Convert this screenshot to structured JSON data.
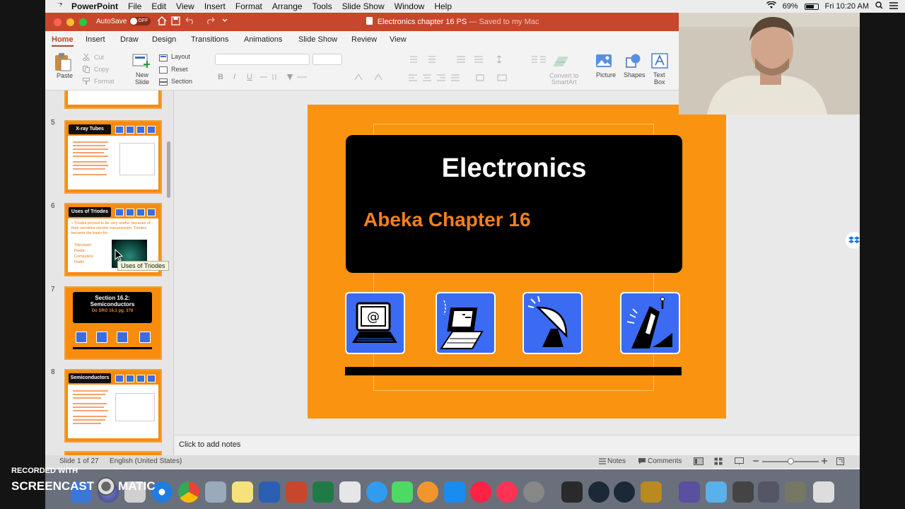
{
  "menubar": {
    "app": "PowerPoint",
    "items": [
      "File",
      "Edit",
      "View",
      "Insert",
      "Format",
      "Arrange",
      "Tools",
      "Slide Show",
      "Window",
      "Help"
    ],
    "battery": "69%",
    "clock": "Fri 10:20 AM"
  },
  "titlebar": {
    "autosave_label": "AutoSave",
    "autosave_state": "OFF",
    "doc_name": "Electronics chapter 16 PS",
    "saved_status": "— Saved to my Mac"
  },
  "tabs": [
    "Home",
    "Insert",
    "Draw",
    "Design",
    "Transitions",
    "Animations",
    "Slide Show",
    "Review",
    "View"
  ],
  "ribbon": {
    "paste": "Paste",
    "cut": "Cut",
    "copy": "Copy",
    "format": "Format",
    "new_slide_1": "New",
    "new_slide_2": "Slide",
    "layout": "Layout",
    "reset": "Reset",
    "section": "Section",
    "bold": "B",
    "italic": "I",
    "underline": "U",
    "convert_1": "Convert to",
    "convert_2": "SmartArt",
    "picture": "Picture",
    "shapes": "Shapes",
    "textbox_1": "Text",
    "textbox_2": "Box"
  },
  "thumbnails": [
    {
      "num": "5",
      "title": "X-ray Tubes"
    },
    {
      "num": "6",
      "title": "Uses of Triodes",
      "bullet": "• Triodes proved to be very useful, because of their sensitive electric transmission. Triodes became the basis for:",
      "items": [
        "Television",
        "Radar",
        "Computers",
        "Radio"
      ]
    },
    {
      "num": "7",
      "title": "Section 16.2: Semiconductors",
      "sub": "Do SRG 16.1 pg. 378"
    },
    {
      "num": "8",
      "title": "Semiconductors"
    }
  ],
  "tooltip": "Uses of Triodes",
  "slide": {
    "title": "Electronics",
    "subtitle": "Abeka Chapter 16",
    "icons": [
      "computer-at-icon",
      "laptop-icon",
      "satellite-dish-icon",
      "mobile-phone-icon"
    ]
  },
  "notes_placeholder": "Click to add notes",
  "status": {
    "slide_count": "Slide 1 of 27",
    "language": "English (United States)",
    "notes": "Notes",
    "comments": "Comments"
  },
  "watermark": {
    "line1": "RECORDED WITH",
    "line2": "SCREENCAST",
    "line3": "MATIC"
  },
  "colors": {
    "ppt_red": "#c8462b",
    "slide_orange": "#fa930f",
    "icon_blue": "#3b6bf2",
    "subtitle_orange": "#f2801e"
  }
}
